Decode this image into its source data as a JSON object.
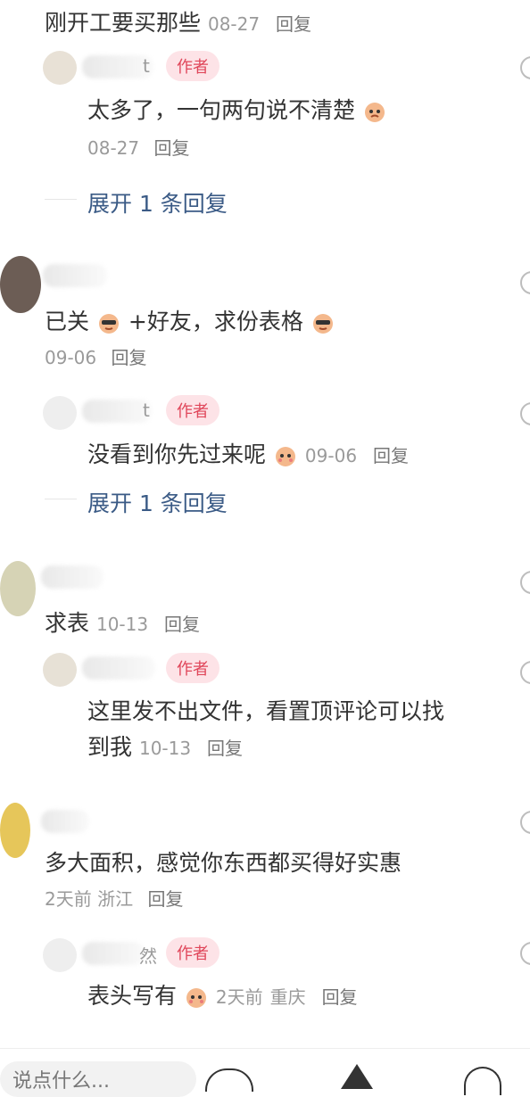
{
  "top_fragment": {
    "text": "刚开工要买那些",
    "time": "08-27",
    "reply": "回复"
  },
  "comments": [
    {
      "reply_text": "太多了，一句两句说不清楚",
      "reply_time": "08-27",
      "reply_label": "回复",
      "author_tag": "作者",
      "expand": "展开 1 条回复",
      "name_tail": "t"
    },
    {
      "text_a": "已关",
      "text_b": "+好友，求份表格",
      "time": "09-06",
      "reply": "回复",
      "reply_text": "没看到你先过来呢",
      "reply_time": "09-06",
      "reply_label": "回复",
      "author_tag": "作者",
      "expand": "展开 1 条回复",
      "name_tail": "t"
    },
    {
      "text": "求表",
      "time": "10-13",
      "reply": "回复",
      "reply_text_1": "这里发不出文件，看置顶评论可以找",
      "reply_text_2": "到我",
      "reply_time": "10-13",
      "reply_label": "回复",
      "author_tag": "作者"
    },
    {
      "text": "多大面积，感觉你东西都买得好实惠",
      "time": "2天前",
      "location": "浙江",
      "reply": "回复",
      "reply_text": "表头写有",
      "reply_time": "2天前",
      "reply_location": "重庆",
      "reply_label": "回复",
      "author_tag": "作者",
      "name_tail": "然"
    }
  ],
  "bottom": {
    "placeholder": "说点什么..."
  },
  "colors": {
    "author_bg": "#fde3e7",
    "author_text": "#e0465a",
    "expand": "#3b5b86"
  }
}
